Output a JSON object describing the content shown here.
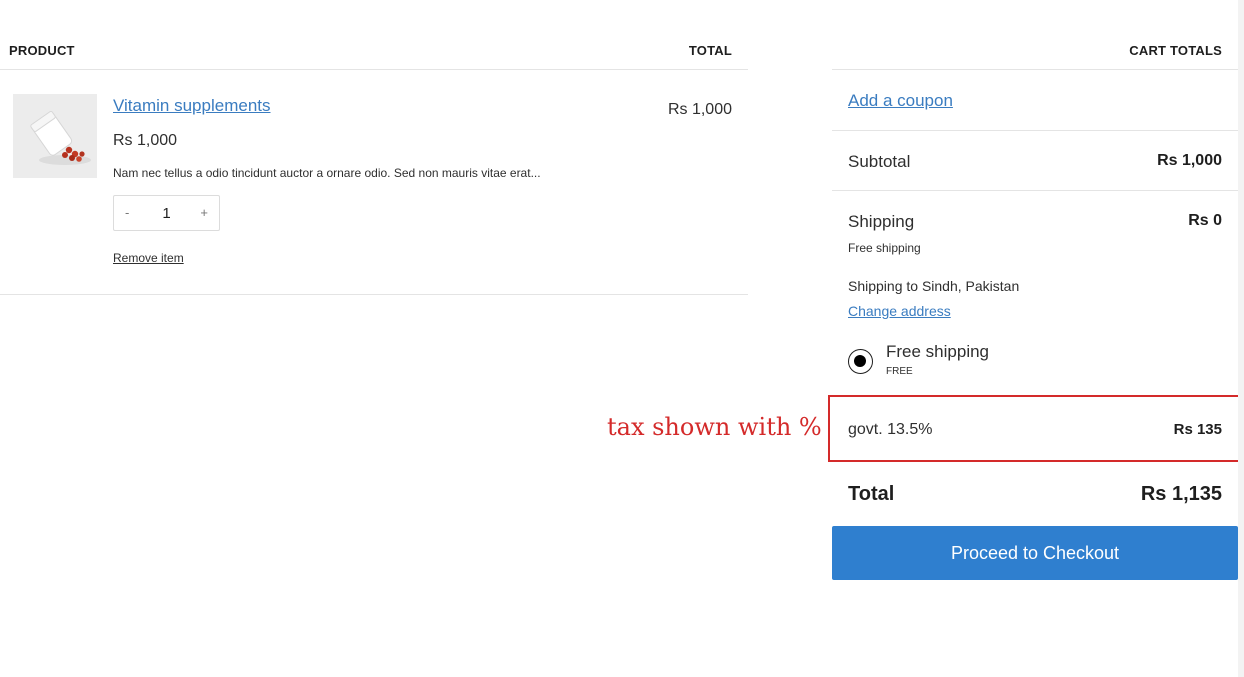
{
  "table": {
    "header_product": "PRODUCT",
    "header_total": "TOTAL"
  },
  "item": {
    "image_icon": "pill-bottle-image",
    "name": "Vitamin supplements",
    "price": "Rs 1,000",
    "description": "Nam nec tellus a odio tincidunt auctor a ornare odio. Sed non mauris vitae erat...",
    "qty_minus": "-",
    "qty_plus": "+",
    "quantity": "1",
    "remove_label": "Remove item",
    "line_total": "Rs 1,000"
  },
  "totals": {
    "title": "CART TOTALS",
    "coupon_label": "Add a coupon",
    "subtotal_label": "Subtotal",
    "subtotal_value": "Rs 1,000",
    "shipping_label": "Shipping",
    "shipping_value": "Rs 0",
    "shipping_note": "Free shipping",
    "shipping_destination": "Shipping to Sindh, Pakistan",
    "change_address": "Change address",
    "method_name": "Free shipping",
    "method_note": "FREE",
    "method_selected": true,
    "tax_label": "govt. 13.5%",
    "tax_value": "Rs 135",
    "total_label": "Total",
    "total_value": "Rs 1,135",
    "checkout_label": "Proceed to Checkout"
  },
  "annotation": {
    "text": "tax shown with %",
    "color": "#d42a2a"
  },
  "colors": {
    "link": "#3a7cc0",
    "button": "#2f7fcf",
    "highlight": "#d42a2a"
  }
}
